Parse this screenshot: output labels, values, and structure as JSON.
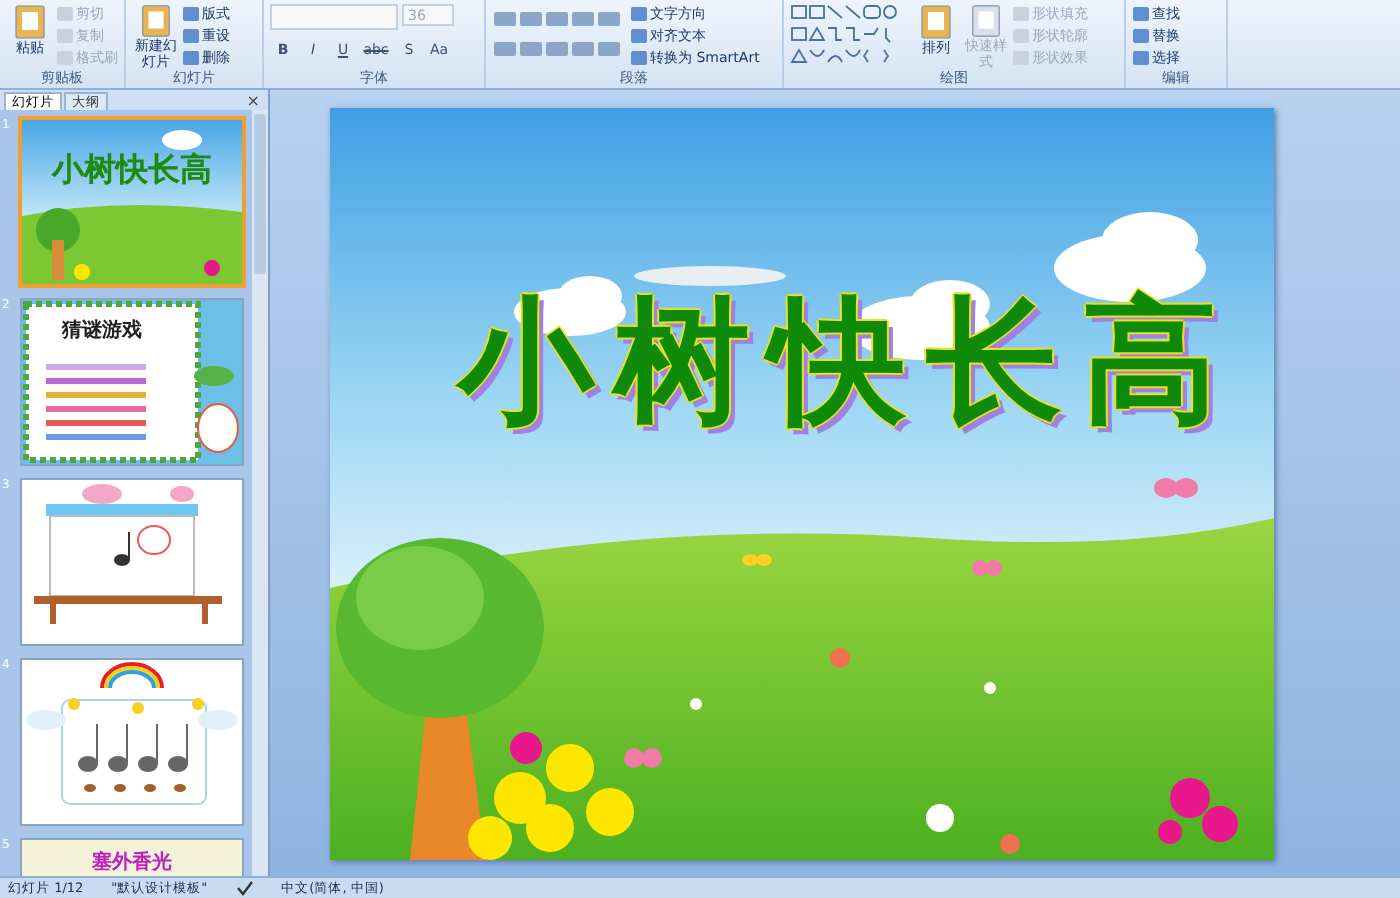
{
  "ribbon": {
    "groups": [
      {
        "label": "剪贴板",
        "buttons": [
          {
            "label": "粘贴",
            "kind": "large",
            "disabled": false
          },
          {
            "label": "剪切",
            "kind": "small",
            "disabled": true
          },
          {
            "label": "复制",
            "kind": "small",
            "disabled": true
          },
          {
            "label": "格式刷",
            "kind": "small",
            "disabled": true
          }
        ]
      },
      {
        "label": "幻灯片",
        "buttons": [
          {
            "label": "新建幻灯片",
            "kind": "large",
            "disabled": false
          },
          {
            "label": "版式",
            "kind": "small",
            "disabled": false
          },
          {
            "label": "重设",
            "kind": "small",
            "disabled": false
          },
          {
            "label": "删除",
            "kind": "small",
            "disabled": false
          }
        ]
      },
      {
        "label": "字体",
        "font_size": "36",
        "format_buttons": [
          "B",
          "I",
          "U",
          "abc",
          "S",
          "Aa"
        ]
      },
      {
        "label": "段落",
        "buttons": [
          {
            "label": "文字方向",
            "kind": "small",
            "disabled": false
          },
          {
            "label": "对齐文本",
            "kind": "small",
            "disabled": false
          },
          {
            "label": "转换为 SmartArt",
            "kind": "small",
            "disabled": false
          }
        ]
      },
      {
        "label": "绘图",
        "buttons": [
          {
            "label": "排列",
            "kind": "large",
            "disabled": false
          },
          {
            "label": "快速样式",
            "kind": "large",
            "disabled": true
          },
          {
            "label": "形状填充",
            "kind": "small",
            "disabled": true
          },
          {
            "label": "形状轮廓",
            "kind": "small",
            "disabled": true
          },
          {
            "label": "形状效果",
            "kind": "small",
            "disabled": true
          }
        ]
      },
      {
        "label": "编辑",
        "buttons": [
          {
            "label": "查找",
            "kind": "small",
            "disabled": false
          },
          {
            "label": "替换",
            "kind": "small",
            "disabled": false
          },
          {
            "label": "选择",
            "kind": "small",
            "disabled": false
          }
        ]
      }
    ]
  },
  "panel": {
    "tabs": [
      {
        "label": "幻灯片",
        "selected": true
      },
      {
        "label": "大纲",
        "selected": false
      }
    ],
    "close": "×",
    "slides": [
      {
        "number": "1",
        "kind": "title",
        "title": "小树快长高",
        "selected": true
      },
      {
        "number": "2",
        "kind": "quiz",
        "title": "猜谜游戏",
        "selected": false
      },
      {
        "number": "3",
        "kind": "board",
        "selected": false
      },
      {
        "number": "4",
        "kind": "notes",
        "selected": false
      },
      {
        "number": "5",
        "kind": "banner",
        "title": "塞外香光",
        "selected": false
      }
    ]
  },
  "slide": {
    "title": "小树快长高"
  },
  "status_bar": {
    "slide": "幻灯片 1/12",
    "theme": "\"默认设计模板\"",
    "language": "中文(简体, 中国)"
  }
}
